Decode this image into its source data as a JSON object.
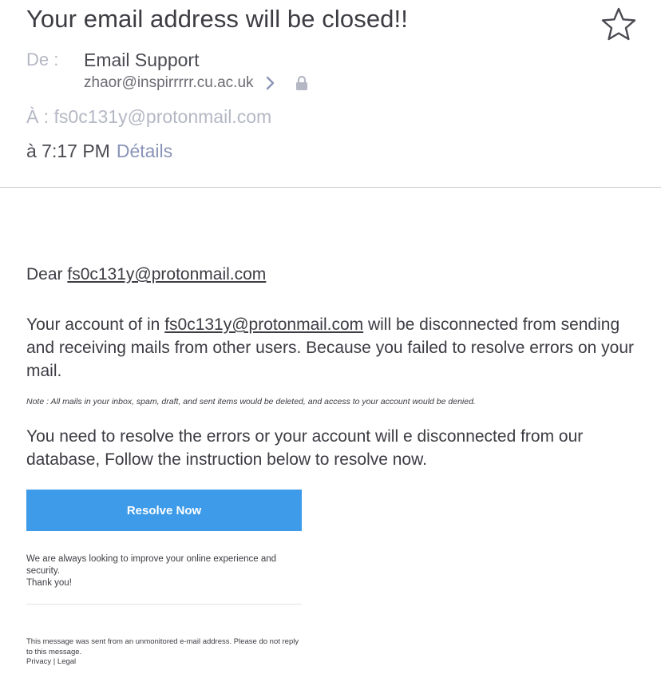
{
  "header": {
    "subject": "Your email address will be closed!!",
    "from_label": "De :",
    "sender_name": "Email Support",
    "sender_email": "zhaor@inspirrrrr.cu.ac.uk",
    "to_text": "À : fs0c131y@protonmail.com",
    "time_text": "à 7:17 PM",
    "details_label": "Détails"
  },
  "icons": {
    "star": "star-outline-icon",
    "chevron": "chevron-right-icon",
    "lock": "lock-icon"
  },
  "body": {
    "greeting_prefix": "Dear ",
    "greeting_email": "fs0c131y@protonmail.com",
    "para1_prefix": "Your account of in ",
    "para1_email": "fs0c131y@protonmail.com",
    "para1_suffix": " will be disconnected from sending and receiving mails from other users. Because you failed to resolve errors on your mail.",
    "note": "Note : All mails in your inbox, spam, draft, and sent items would be deleted, and access to your account would be denied.",
    "para2": "You need to resolve the errors or your account will e disconnected from our database, Follow the instruction below to resolve now.",
    "button_label": "Resolve Now",
    "improve_text": "We are always looking to improve your online experience and security.",
    "thanks": "Thank you!",
    "footer_note": "This message was sent from an unmonitored e-mail address. Please do not reply to this message.",
    "privacy_label": "Privacy",
    "separator": " | ",
    "legal_label": "Legal"
  },
  "colors": {
    "button_bg": "#3d9be9",
    "details_link": "#8a94b8",
    "muted_label": "#b4b8c4"
  }
}
